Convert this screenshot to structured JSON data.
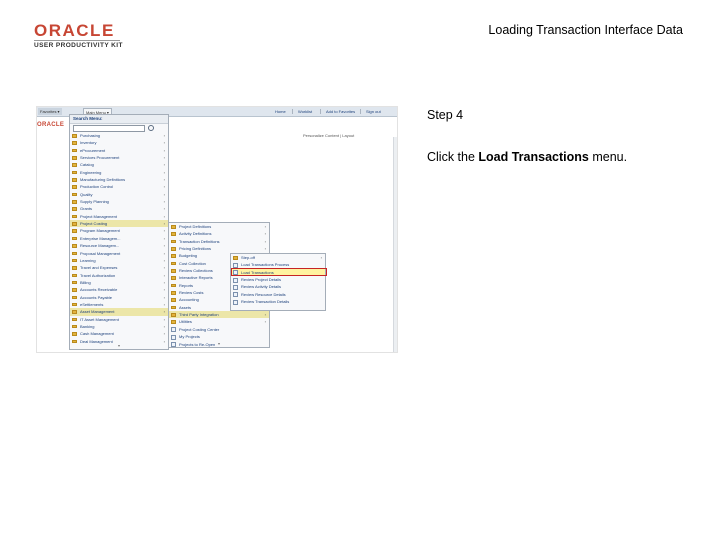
{
  "header": {
    "logo_oracle": "ORACLE",
    "logo_product": "USER PRODUCTIVITY KIT",
    "title": "Loading Transaction Interface Data"
  },
  "step": {
    "label": "Step 4"
  },
  "instruction": {
    "prefix": "Click the ",
    "target": "Load Transactions",
    "suffix": " menu."
  },
  "screenshot": {
    "topbar": {
      "nav1": "Favorites ▾",
      "nav2": "Main Menu ▾",
      "links": [
        "Home",
        "Worklist",
        "Add to Favorites",
        "Sign out"
      ]
    },
    "brand": "ORACLE",
    "personalize": "Personalize Content | Layout",
    "search_label": "Search Menu:",
    "menu1_items": [
      "Purchasing",
      "Inventory",
      "eProcurement",
      "Services Procurement",
      "Catalog",
      "Engineering",
      "Manufacturing Definitions",
      "Production Control",
      "Quality",
      "Supply Planning",
      "Grants",
      "Project Management",
      "Project Costing",
      "Program Management",
      "Enterprise Managem...",
      "Resource Managem...",
      "Proposal Management",
      "Learning",
      "Travel and Expenses",
      "Travel Authorization",
      "Billing",
      "Accounts Receivable",
      "Accounts Payable",
      "eSettlements",
      "Asset Management",
      "IT Asset Management",
      "Banking",
      "Cash Management",
      "Deal Management"
    ],
    "menu2_items": [
      "Project Definitions",
      "Activity Definitions",
      "Transaction Definitions",
      "Pricing Definitions",
      "Budgeting",
      "Cost Collection",
      "Review Collections",
      "Interactive Reports",
      "Reports",
      "Review Costs",
      "Accounting",
      "Assets",
      "Third Party Integration",
      "Utilities",
      "Project Costing Center",
      "My Projects",
      "Projects to Re-Open"
    ],
    "menu3_items": [
      "Step-off",
      "Load Transactions Process",
      "Load Transactions",
      "Review Project Details",
      "Review Activity Details",
      "Review Resource Details",
      "Review Transaction Details"
    ]
  }
}
